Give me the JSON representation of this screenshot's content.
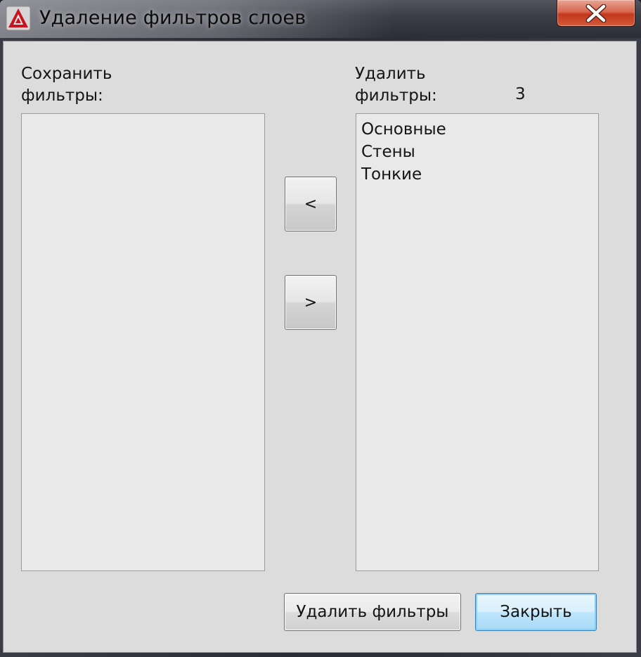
{
  "window": {
    "title": "Удаление фильтров слоев",
    "icon": "autocad-logo-icon",
    "close_icon": "close-icon"
  },
  "keep_list": {
    "label_line1": "Сохранить",
    "label_line2": "фильтры:",
    "items": []
  },
  "delete_list": {
    "label_line1": "Удалить",
    "label_line2": "фильтры:",
    "count": "3",
    "items": [
      "Основные",
      "Стены",
      "Тонкие"
    ]
  },
  "buttons": {
    "move_left": "<",
    "move_right": ">",
    "delete_filters": "Удалить фильтры",
    "close": "Закрыть"
  },
  "colors": {
    "client_bg": "#dcdcdc",
    "list_bg": "#e9e9e9",
    "close_red": "#c2391d",
    "default_button_border": "#3c7fb1",
    "logo_red": "#c8141e"
  }
}
